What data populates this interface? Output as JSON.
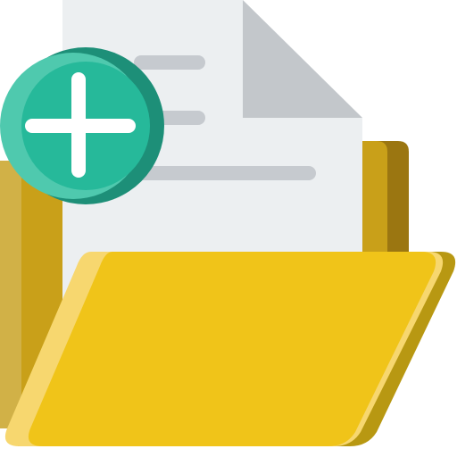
{
  "icon": {
    "name": "add-to-folder-icon",
    "parts": [
      "folder-icon",
      "document-icon",
      "plus-icon"
    ]
  },
  "colors": {
    "folder_back_light": "#d1b147",
    "folder_back_mid": "#c9a019",
    "folder_back_dark": "#9b7611",
    "folder_front": "#f0c419",
    "folder_front_highlight": "#f7d76f",
    "folder_front_shadow": "#b89812",
    "paper": "#eceff1",
    "paper_fold": "#c3c7cb",
    "paper_lines": "#c6cacf",
    "badge_light": "#4fc9ae",
    "badge": "#26b99a",
    "badge_dark": "#1d8f78",
    "plus": "#ffffff"
  }
}
